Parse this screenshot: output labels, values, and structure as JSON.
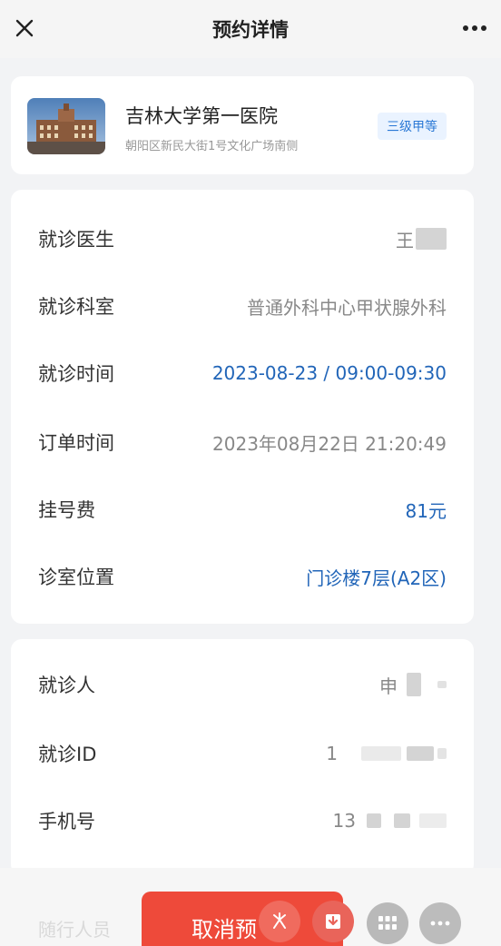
{
  "navbar": {
    "title": "预约详情",
    "close_icon": "close-icon",
    "more_icon": "more-icon"
  },
  "hospital": {
    "name": "吉林大学第一医院",
    "address": "朝阳区新民大街1号文化广场南侧",
    "level": "三级甲等",
    "image_icon": "hospital-building-photo"
  },
  "details": [
    {
      "label": "就诊医生",
      "value": "王",
      "highlight": false,
      "masked": true
    },
    {
      "label": "就诊科室",
      "value": "普通外科中心甲状腺外科",
      "highlight": false,
      "masked": false
    },
    {
      "label": "就诊时间",
      "value": "2023-08-23 / 09:00-09:30",
      "highlight": true,
      "masked": false
    },
    {
      "label": "订单时间",
      "value": "2023年08月22日 21:20:49",
      "highlight": false,
      "masked": false
    },
    {
      "label": "挂号费",
      "value": "81元",
      "highlight": true,
      "masked": false
    },
    {
      "label": "诊室位置",
      "value": "门诊楼7层(A2区)",
      "highlight": true,
      "masked": false
    }
  ],
  "patient": [
    {
      "label": "就诊人",
      "value": "申",
      "masked": true
    },
    {
      "label": "就诊ID",
      "value": "1",
      "masked": true
    },
    {
      "label": "手机号",
      "value": "13",
      "masked": true
    }
  ],
  "footer": {
    "ghost_text": "随行人员",
    "cancel_label": "取消预",
    "fab_icons": [
      "sparkle-icon",
      "download-icon",
      "grid-icon",
      "more-icon"
    ]
  },
  "colors": {
    "accent_blue": "#2165b8",
    "cancel_red": "#ee4a3a",
    "badge_bg": "#eaf3ff"
  }
}
